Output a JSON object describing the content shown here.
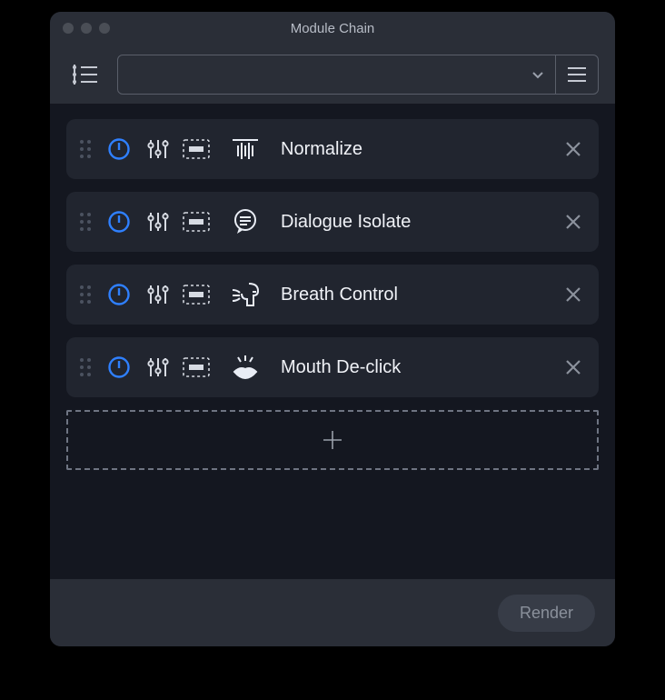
{
  "window": {
    "title": "Module Chain"
  },
  "toolbar": {
    "preset_value": ""
  },
  "modules": [
    {
      "name": "Normalize",
      "icon": "normalize"
    },
    {
      "name": "Dialogue Isolate",
      "icon": "dialogue"
    },
    {
      "name": "Breath Control",
      "icon": "breath"
    },
    {
      "name": "Mouth De-click",
      "icon": "mouth"
    }
  ],
  "footer": {
    "render_label": "Render"
  }
}
